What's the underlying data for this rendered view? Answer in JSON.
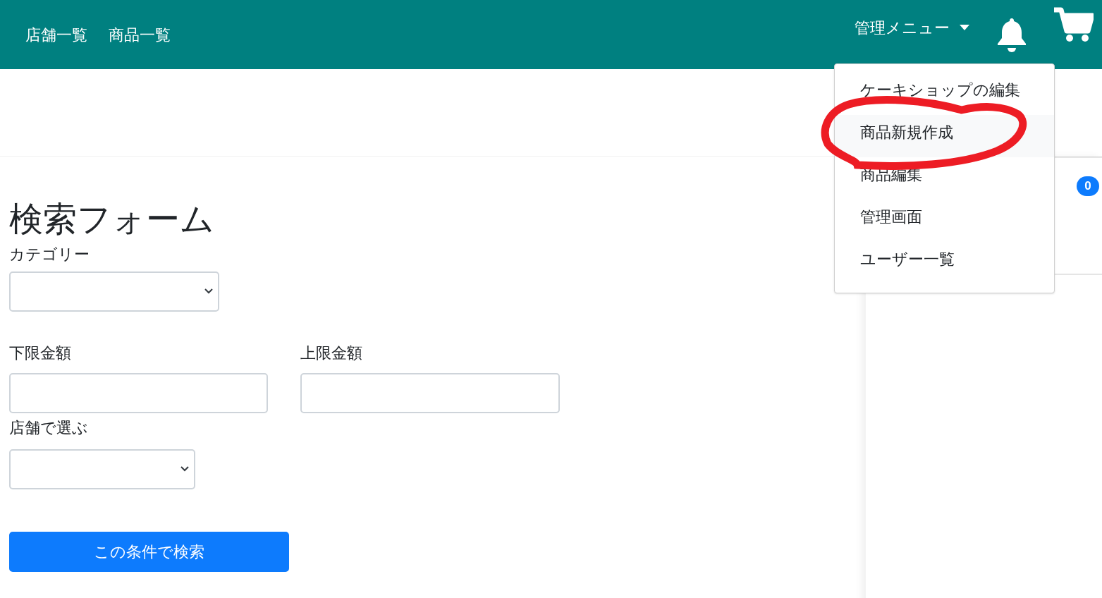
{
  "navbar": {
    "links": [
      "店舗一覧",
      "商品一覧"
    ],
    "admin_menu": {
      "label": "管理メニュー",
      "expanded": true,
      "items": [
        {
          "label": "ケーキショップの編集",
          "selected": false
        },
        {
          "label": "商品新規作成",
          "selected": true
        },
        {
          "label": "商品編集",
          "selected": false
        },
        {
          "label": "管理画面",
          "selected": false
        },
        {
          "label": "ユーザー一覧",
          "selected": false
        }
      ]
    }
  },
  "sidebar": {
    "badge": "0"
  },
  "search_form": {
    "title": "検索フォーム",
    "category_label": "カテゴリー",
    "min_price_label": "下限金額",
    "max_price_label": "上限金額",
    "shop_label": "店舗で選ぶ",
    "submit": "この条件で検索"
  }
}
